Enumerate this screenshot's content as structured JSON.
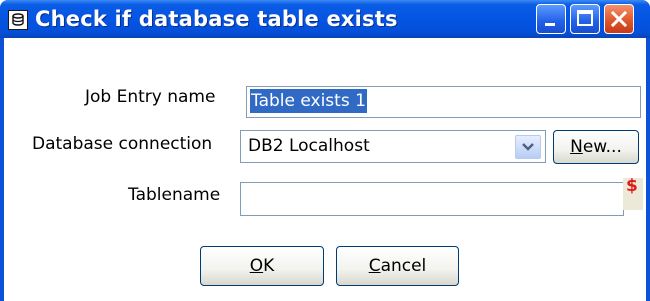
{
  "window": {
    "title": "Check if database table exists",
    "controls": {
      "minimize": "minimize-icon",
      "maximize": "maximize-icon",
      "close": "close-icon"
    }
  },
  "form": {
    "job_entry_name": {
      "label": "Job Entry name",
      "value": "Table exists 1",
      "selected": true
    },
    "database_connection": {
      "label": "Database connection",
      "value": "DB2 Localhost",
      "new_button": {
        "prefix": "N",
        "rest": "ew..."
      }
    },
    "tablename": {
      "label": "Tablename",
      "value": "",
      "variable_icon": "$"
    }
  },
  "buttons": {
    "ok": {
      "mnemonic": "O",
      "rest": "K"
    },
    "cancel": {
      "mnemonic": "C",
      "rest": "ancel"
    }
  },
  "colors": {
    "titlebar": "#0554e3",
    "selection": "#316ac5",
    "variable_icon": "#e11a1a"
  }
}
